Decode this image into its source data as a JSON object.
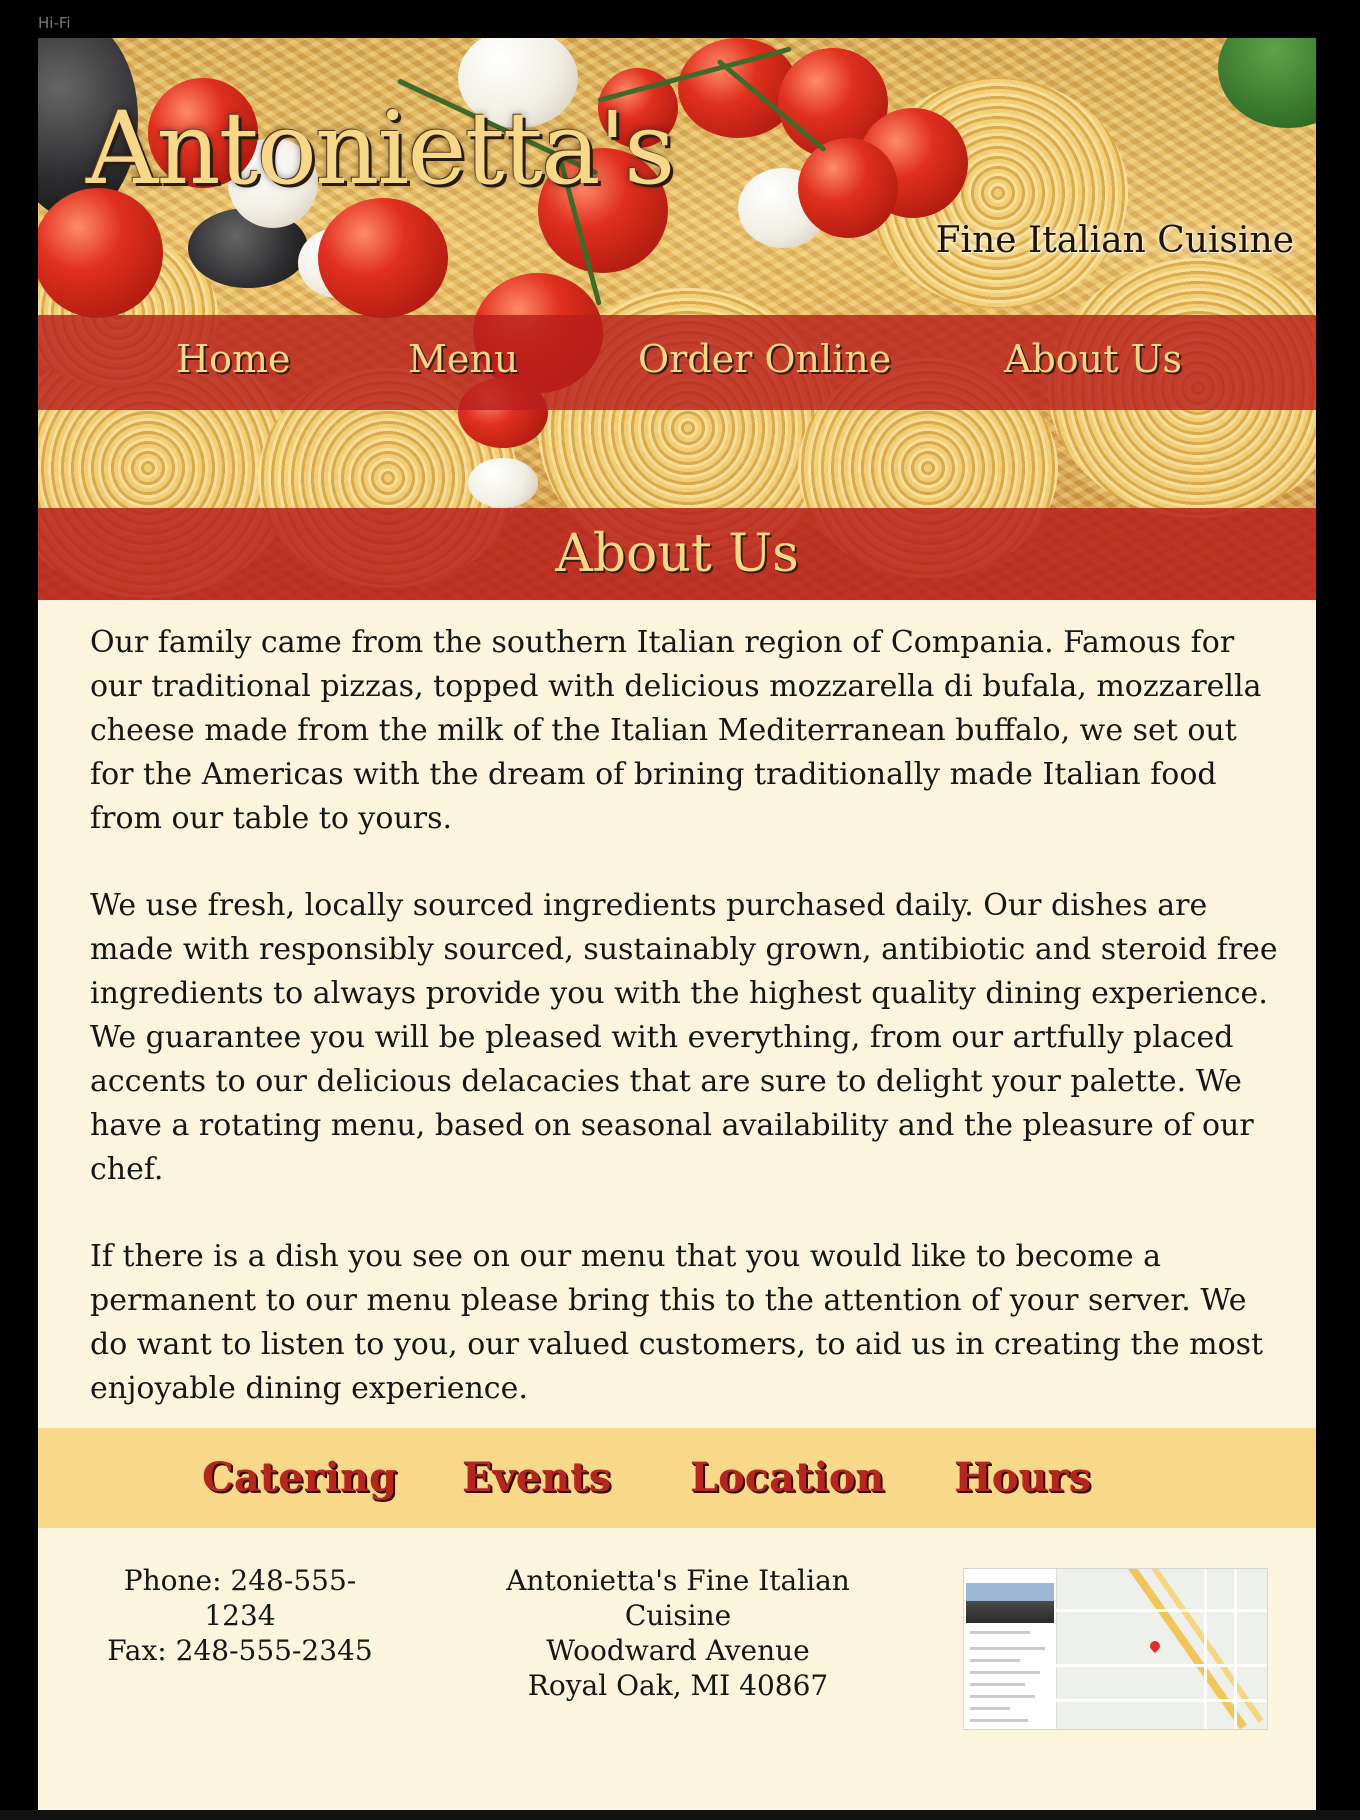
{
  "frame_label": "Hi-Fi",
  "brand": {
    "name": "Antonietta's",
    "tagline": "Fine Italian Cuisine"
  },
  "nav": {
    "items": [
      "Home",
      "Menu",
      "Order Online",
      "About Us"
    ]
  },
  "page_title": "About Us",
  "content": {
    "paragraphs": [
      "Our family came from the southern Italian region of Compania.  Famous for our traditional pizzas, topped with delicious mozzarella di bufala, mozzarella cheese made from the milk of the Italian Mediterranean buffalo, we set out for the Americas with the dream of brining traditionally made Italian food from our table to yours.",
      "We use fresh, locally sourced ingredients purchased daily.  Our dishes are made with responsibly sourced, sustainably grown, antibiotic and steroid free ingredients to always provide you with the highest quality dining experience.  We guarantee you will be pleased with everything, from our artfully placed accents to our delicious delacacies that are sure to delight your palette. We have a rotating menu, based on seasonal availability and the pleasure of our chef.",
      "If there is a dish you see on our menu that you would like to become a permanent to our menu please bring this to the attention of your server.  We do want to listen to you, our valued customers, to aid us in creating the most enjoyable dining experience."
    ]
  },
  "footer_links": {
    "items": [
      "Catering",
      "Events",
      "Location",
      "Hours"
    ]
  },
  "contact": {
    "phone": "Phone: 248-555-1234",
    "fax": "Fax: 248-555-2345"
  },
  "address": {
    "line1": "Antonietta's Fine Italian Cuisine",
    "line2": "Woodward Avenue",
    "line3": "Royal Oak, MI 40867"
  },
  "colors": {
    "nav_red": "#b81e1c",
    "gold_text": "#f6d888",
    "cream_bg": "#fdf4dd",
    "link_bar": "#f8d98a",
    "link_red": "#b3271f"
  },
  "icons": {
    "map": "map-thumbnail"
  }
}
